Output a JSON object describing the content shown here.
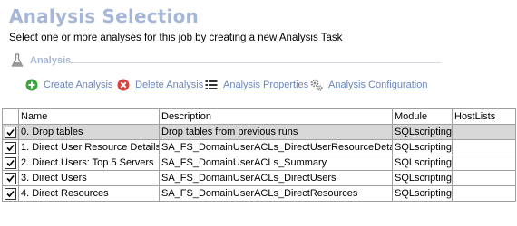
{
  "header": {
    "title": "Analysis Selection",
    "subtitle": "Select one or more analyses for this job by creating a new Analysis Task"
  },
  "section": {
    "label": "Analysis",
    "icon": "flask-icon"
  },
  "toolbar": {
    "create": {
      "label": "Create Analysis",
      "icon": "plus-circle-icon",
      "color": "#3aa73a"
    },
    "delete": {
      "label": "Delete Analysis",
      "icon": "delete-x-circle-icon",
      "color": "#d9433b"
    },
    "properties": {
      "label": "Analysis Properties",
      "icon": "list-icon"
    },
    "configuration": {
      "label": "Analysis Configuration",
      "icon": "gears-icon"
    }
  },
  "table": {
    "columns": [
      "",
      "Name",
      "Description",
      "Module",
      "HostLists"
    ],
    "rows": [
      {
        "checked": true,
        "name": "0. Drop tables",
        "description": "Drop tables from previous runs",
        "module": "SQLscripting",
        "hostlists": ""
      },
      {
        "checked": true,
        "name": "1. Direct User Resource Details",
        "description": "SA_FS_DomainUserACLs_DirectUserResourceDetails",
        "module": "SQLscripting",
        "hostlists": ""
      },
      {
        "checked": true,
        "name": "2. Direct Users: Top 5 Servers",
        "description": "SA_FS_DomainUserACLs_Summary",
        "module": "SQLscripting",
        "hostlists": ""
      },
      {
        "checked": true,
        "name": "3. Direct Users",
        "description": "SA_FS_DomainUserACLs_DirectUsers",
        "module": "SQLscripting",
        "hostlists": ""
      },
      {
        "checked": true,
        "name": "4. Direct Resources",
        "description": "SA_FS_DomainUserACLs_DirectResources",
        "module": "SQLscripting",
        "hostlists": ""
      }
    ]
  },
  "colors": {
    "title": "#a6b6d6",
    "link": "#6c86b8",
    "selected_row": "#d8d8d8"
  }
}
